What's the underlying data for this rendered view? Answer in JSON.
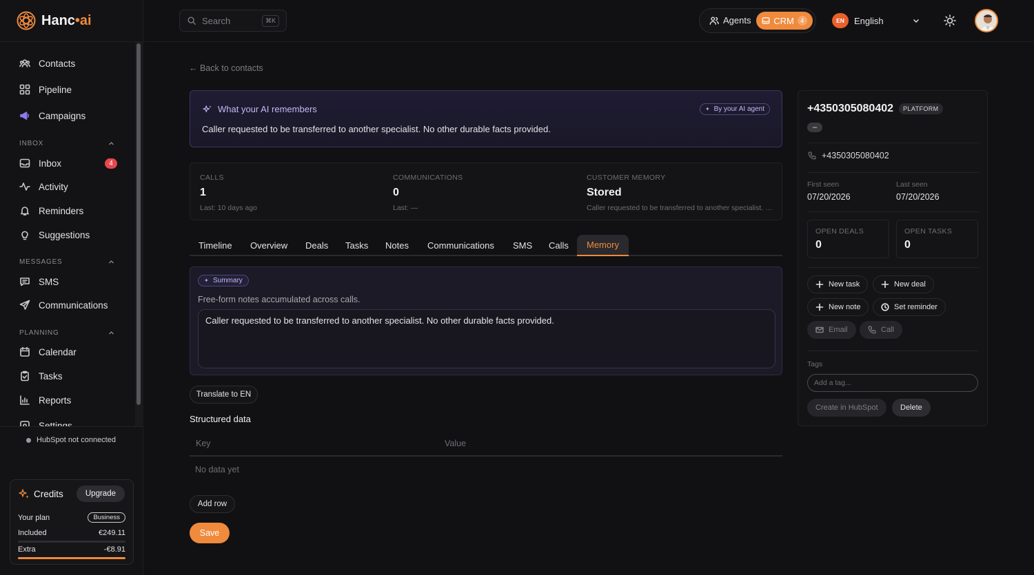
{
  "app": {
    "logo_text": "Hanc",
    "logo_suffix": "ai",
    "accent": "#f08a3c"
  },
  "sidebar": {
    "items": [
      {
        "label": "Contacts",
        "icon": "users-icon"
      },
      {
        "label": "Pipeline",
        "icon": "grid-icon"
      },
      {
        "label": "Campaigns",
        "icon": "megaphone-icon"
      }
    ],
    "sections": {
      "inbox": "INBOX",
      "messages": "MESSAGES",
      "planning": "PLANNING"
    },
    "inbox_items": [
      {
        "label": "Inbox",
        "badge": "4"
      },
      {
        "label": "Activity"
      },
      {
        "label": "Reminders"
      },
      {
        "label": "Suggestions"
      }
    ],
    "message_items": [
      {
        "label": "SMS"
      },
      {
        "label": "Communications"
      }
    ],
    "planning_items": [
      {
        "label": "Calendar"
      },
      {
        "label": "Tasks"
      },
      {
        "label": "Reports"
      },
      {
        "label": "Settings"
      }
    ],
    "hubspot_status": "HubSpot not connected",
    "credits": {
      "title": "Credits",
      "upgrade": "Upgrade",
      "plan_label": "Your plan",
      "plan_value": "Business",
      "included_label": "Included",
      "included_value": "€249.11",
      "extra_label": "Extra",
      "extra_value": "-€8.91"
    }
  },
  "header": {
    "search_placeholder": "Search",
    "search_shortcut": "⌘K",
    "agents": "Agents",
    "crm": "CRM",
    "crm_badge": "4",
    "lang_code": "EN",
    "lang_label": "English"
  },
  "main": {
    "back": "← Back to contacts",
    "memory": {
      "title": "What your AI remembers",
      "by": "By your AI agent",
      "text": "Caller requested to be transferred to another specialist. No other durable facts provided."
    },
    "stats": [
      {
        "label": "CALLS",
        "value": "1",
        "sub": "Last: 10 days ago"
      },
      {
        "label": "COMMUNICATIONS",
        "value": "0",
        "sub": "Last: —"
      },
      {
        "label": "CUSTOMER MEMORY",
        "value": "Stored",
        "sub": "Caller requested to be transferred to another specialist. No other durable facts provided."
      }
    ],
    "tabs": [
      "Timeline",
      "Overview",
      "Deals",
      "Tasks",
      "Notes",
      "Communications",
      "SMS",
      "Calls",
      "Memory"
    ],
    "active_tab": "Memory",
    "summary": {
      "chip": "Summary",
      "desc": "Free-form notes accumulated across calls.",
      "value": "Caller requested to be transferred to another specialist. No other durable facts provided."
    },
    "translate": "Translate to EN",
    "structured": {
      "title": "Structured data",
      "key_col": "Key",
      "value_col": "Value",
      "empty": "No data yet",
      "add_row": "Add row"
    },
    "save": "Save"
  },
  "contact": {
    "phone": "+4350305080402",
    "platform": "PLATFORM",
    "pill": "–",
    "tel": "+4350305080402",
    "first_seen_label": "First seen",
    "first_seen": "07/20/2026",
    "last_seen_label": "Last seen",
    "last_seen": "07/20/2026",
    "open_deals_label": "OPEN DEALS",
    "open_deals": "0",
    "open_tasks_label": "OPEN TASKS",
    "open_tasks": "0",
    "actions": {
      "new_task": "New task",
      "new_deal": "New deal",
      "new_note": "New note",
      "set_reminder": "Set reminder",
      "email": "Email",
      "call": "Call"
    },
    "tags_label": "Tags",
    "tag_placeholder": "Add a tag...",
    "create_hubspot": "Create in HubSpot",
    "delete": "Delete"
  }
}
